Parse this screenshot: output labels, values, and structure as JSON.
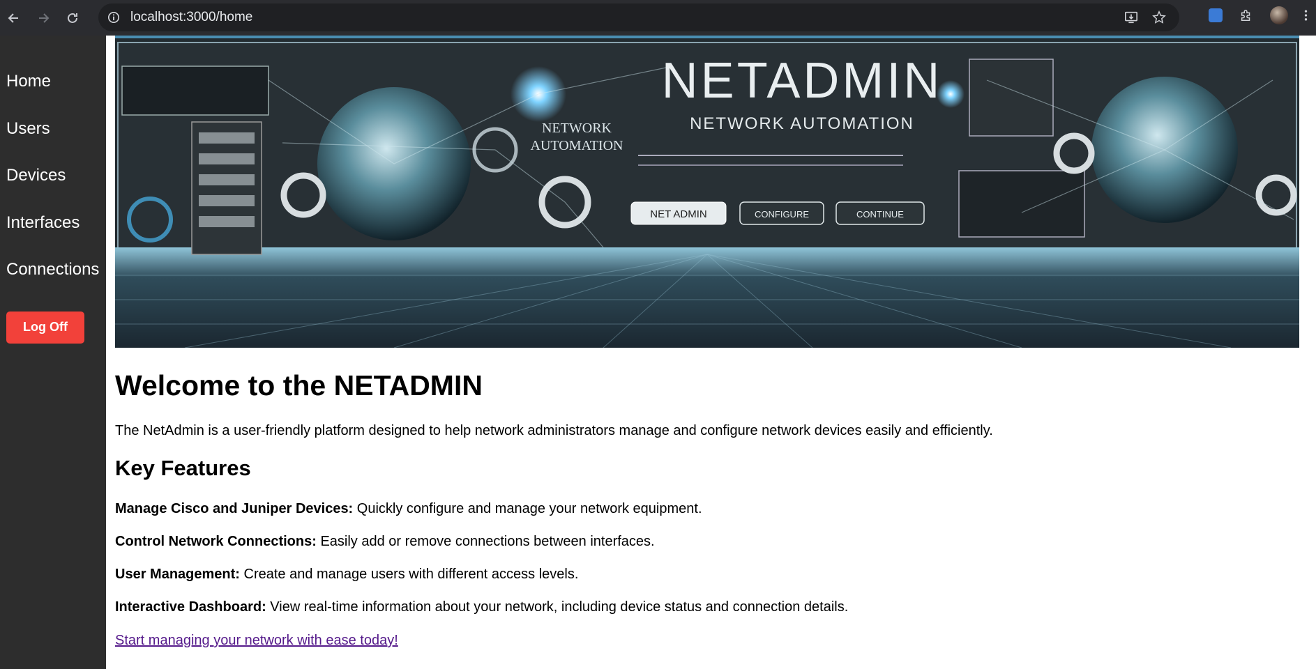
{
  "browser": {
    "url": "localhost:3000/home"
  },
  "sidebar": {
    "items": [
      {
        "label": "Home"
      },
      {
        "label": "Users"
      },
      {
        "label": "Devices"
      },
      {
        "label": "Interfaces"
      },
      {
        "label": "Connections"
      }
    ],
    "logoff_label": "Log Off",
    "background": "#2d2d2d",
    "logoff_color": "#f2413a"
  },
  "banner": {
    "title": "NETADMIN",
    "subtitle": "NETWORK AUTOMATION",
    "side_text_line1": "NETWORK",
    "side_text_line2": "AUTOMATION",
    "btn1": "NET ADMIN",
    "btn2": "CONFIGURE",
    "btn3": "CONTINUE"
  },
  "main": {
    "heading": "Welcome to the NETADMIN",
    "intro": "The NetAdmin is a user-friendly platform designed to help network administrators manage and configure network devices easily and efficiently.",
    "features_heading": "Key Features",
    "features": [
      {
        "title": "Manage Cisco and Juniper Devices:",
        "text": " Quickly configure and manage your network equipment."
      },
      {
        "title": "Control Network Connections:",
        "text": " Easily add or remove connections between interfaces."
      },
      {
        "title": "User Management:",
        "text": " Create and manage users with different access levels."
      },
      {
        "title": "Interactive Dashboard:",
        "text": " View real-time information about your network, including device status and connection details."
      }
    ],
    "cta": "Start managing your network with ease today!",
    "cta_color": "#551a8b"
  }
}
